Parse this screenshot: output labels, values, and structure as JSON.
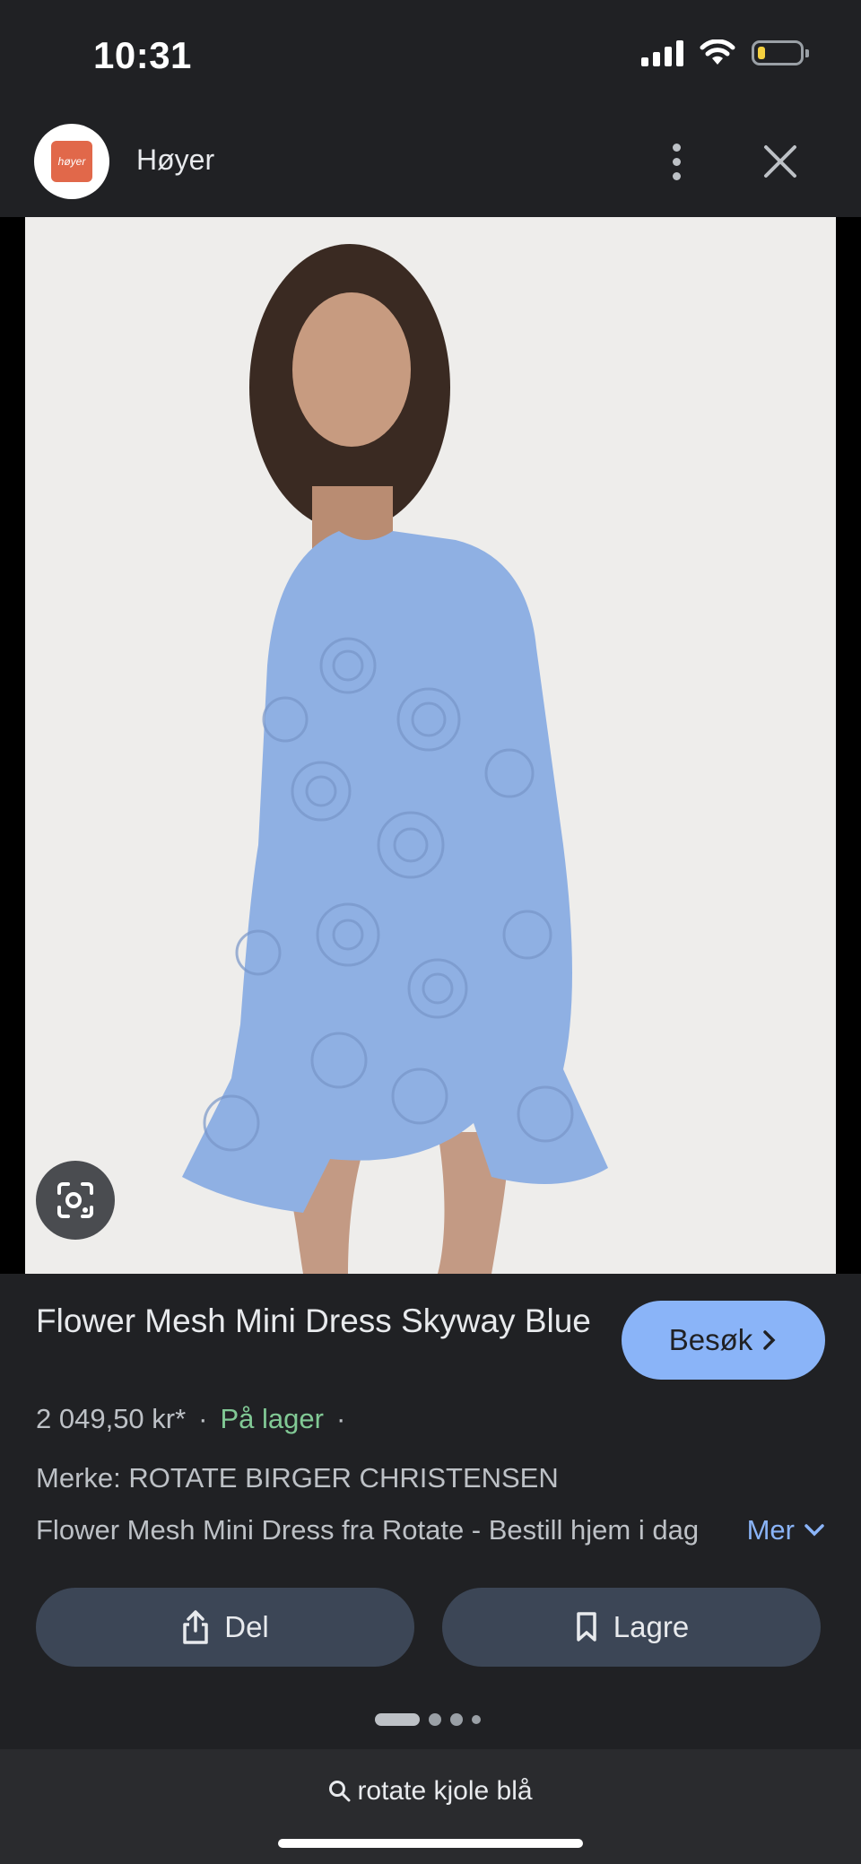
{
  "status_bar": {
    "time": "10:31",
    "battery_level": 0.15
  },
  "header": {
    "site_name": "Høyer",
    "logo_text": "høyer"
  },
  "image": {
    "alt": "Flower Mesh Mini Dress Skyway Blue"
  },
  "product": {
    "title": "Flower Mesh Mini Dress Skyway Blue",
    "price": "2 049,50 kr*",
    "separator": "·",
    "stock": "På lager",
    "brand": "Merke: ROTATE BIRGER CHRISTENSEN",
    "description": "Flower Mesh Mini Dress fra Rotate - Bestill hjem i dag",
    "more_label": "Mer"
  },
  "actions": {
    "visit_label": "Besøk",
    "share_label": "Del",
    "save_label": "Lagre"
  },
  "pager": {
    "count": 4,
    "active_index": 0
  },
  "search": {
    "query": "rotate kjole blå"
  },
  "colors": {
    "accent": "#8ab4f8",
    "stock_green": "#81c995",
    "dress_blue": "#8fb0e3",
    "background": "#202124",
    "button_bg": "#3c4656"
  }
}
